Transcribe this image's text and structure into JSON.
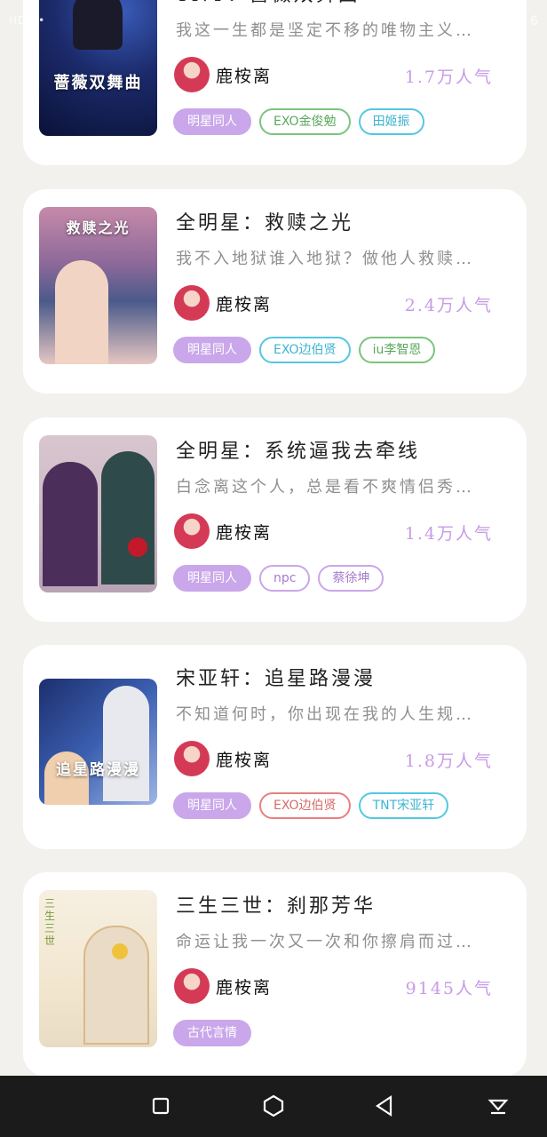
{
  "status_bar": {
    "left": "HD ••",
    "right": "6"
  },
  "books": [
    {
      "title": "TNT：蔷薇双舞曲",
      "description": "我这一生都是坚定不移的唯物主义…",
      "author": "鹿桉离",
      "popularity": "1.7万人气",
      "cover_text": "蔷薇双舞曲",
      "tags": [
        "明星同人",
        "EXO金俊勉",
        "田姬振"
      ]
    },
    {
      "title": "全明星：救赎之光",
      "description": "我不入地狱谁入地狱？做他人救赎…",
      "author": "鹿桉离",
      "popularity": "2.4万人气",
      "cover_text": "救赎之光",
      "tags": [
        "明星同人",
        "EXO边伯贤",
        "iu李智恩"
      ]
    },
    {
      "title": "全明星：系统逼我去牵线",
      "description": "白念离这个人，总是看不爽情侣秀…",
      "author": "鹿桉离",
      "popularity": "1.4万人气",
      "cover_text": "",
      "tags": [
        "明星同人",
        "npc",
        "蔡徐坤"
      ]
    },
    {
      "title": "宋亚轩：追星路漫漫",
      "description": "不知道何时，你出现在我的人生规…",
      "author": "鹿桉离",
      "popularity": "1.8万人气",
      "cover_text": "追星路漫漫",
      "tags": [
        "明星同人",
        "EXO边伯贤",
        "TNT宋亚轩"
      ]
    },
    {
      "title": "三生三世：刹那芳华",
      "description": "命运让我一次又一次和你擦肩而过…",
      "author": "鹿桉离",
      "popularity": "9145人气",
      "cover_text": "三生三世",
      "tags": [
        "古代言情"
      ]
    }
  ],
  "colors": {
    "accent": "#c9a7ea",
    "popularity": "#c79be8",
    "background": "#f2f1ee",
    "nav_bar": "#1b1b1b"
  },
  "nav_icons": [
    "square-icon",
    "hexagon-icon",
    "back-triangle-icon",
    "download-icon"
  ]
}
